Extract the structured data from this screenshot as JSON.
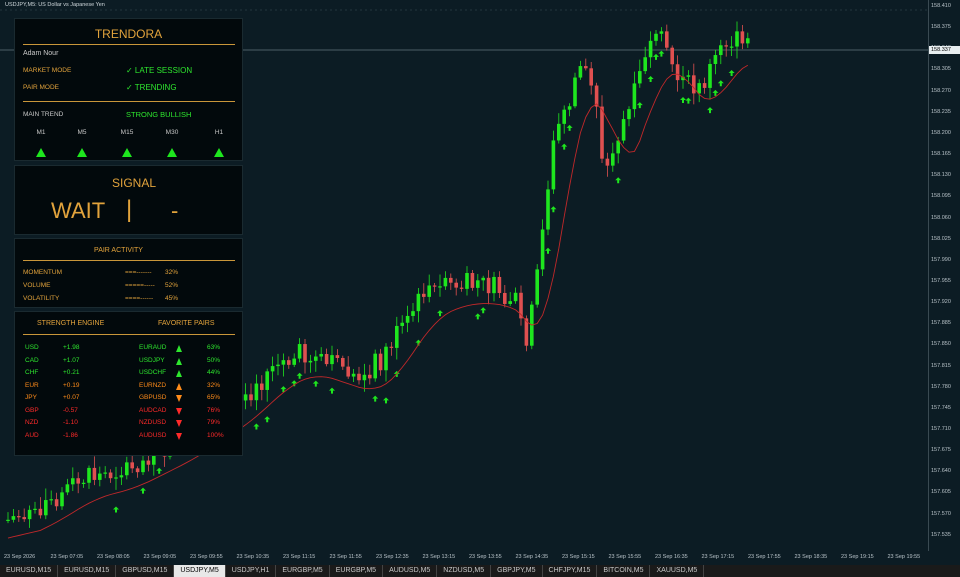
{
  "chart_title": "USDJPY,M5:  US Dollar vs Japanese Yen",
  "colors": {
    "bull": "#1ee61e",
    "bear": "#e05050",
    "ma": "#c0282a",
    "arrow": "#1ee61e",
    "bg": "#0c1c24"
  },
  "price_axis": [
    "158.410",
    "158.375",
    "158.340",
    "158.305",
    "158.270",
    "158.235",
    "158.200",
    "158.165",
    "158.130",
    "158.095",
    "158.060",
    "158.025",
    "157.990",
    "157.955",
    "157.920",
    "157.885",
    "157.850",
    "157.815",
    "157.780",
    "157.745",
    "157.710",
    "157.675",
    "157.640",
    "157.605",
    "157.570",
    "157.535"
  ],
  "current_price": "158.337",
  "time_axis": [
    "23 Sep 2026",
    "23 Sep 07:05",
    "23 Sep 08:05",
    "23 Sep 09:05",
    "23 Sep 09:55",
    "23 Sep 10:35",
    "23 Sep 11:15",
    "23 Sep 11:55",
    "23 Sep 12:35",
    "23 Sep 13:15",
    "23 Sep 13:55",
    "23 Sep 14:35",
    "23 Sep 15:15",
    "23 Sep 15:55",
    "23 Sep 16:35",
    "23 Sep 17:15",
    "23 Sep 17:55",
    "23 Sep 18:35",
    "23 Sep 19:15",
    "23 Sep 19:55"
  ],
  "tabs": [
    "EURUSD,M15",
    "EURUSD,M15",
    "GBPUSD,M15",
    "USDJPY,M5",
    "USDJPY,H1",
    "EURGBP,M5",
    "EURGBP,M5",
    "AUDUSD,M5",
    "NZDUSD,M5",
    "GBPJPY,M5",
    "CHFJPY,M15",
    "BITCOIN,M5",
    "XAUUSD,M5"
  ],
  "active_tab": 3,
  "panel": {
    "brand": "TRENDORA",
    "user": "Adam Nour",
    "market_mode_label": "MARKET MODE",
    "market_mode_value": "✓ LATE SESSION",
    "pair_mode_label": "PAIR MODE",
    "pair_mode_value": "✓ TRENDING",
    "main_trend_label": "MAIN TREND",
    "main_trend_value": "STRONG BULLISH",
    "timeframes": [
      "M1",
      "M5",
      "M15",
      "M30",
      "H1"
    ],
    "signal_label": "SIGNAL",
    "signal_value": "WAIT",
    "signal_sep": "|",
    "signal_dir": "-",
    "activity_title": "PAIR ACTIVITY",
    "activity": [
      {
        "label": "MOMENTUM",
        "bar": "===-------",
        "pct": "32%"
      },
      {
        "label": "VOLUME",
        "bar": "=====-----",
        "pct": "52%"
      },
      {
        "label": "VOLATILITY",
        "bar": "====------",
        "pct": "45%"
      }
    ],
    "strength_title": "STRENGTH ENGINE",
    "favorites_title": "FAVORITE PAIRS",
    "strength": [
      {
        "cur": "USD",
        "val": "+1.98",
        "color": "green"
      },
      {
        "cur": "CAD",
        "val": "+1.07",
        "color": "green"
      },
      {
        "cur": "CHF",
        "val": "+0.21",
        "color": "green"
      },
      {
        "cur": "EUR",
        "val": "+0.19",
        "color": "orange"
      },
      {
        "cur": "JPY",
        "val": "+0.07",
        "color": "orange"
      },
      {
        "cur": "GBP",
        "val": "-0.57",
        "color": "red"
      },
      {
        "cur": "NZD",
        "val": "-1.10",
        "color": "red"
      },
      {
        "cur": "AUD",
        "val": "-1.86",
        "color": "red"
      }
    ],
    "favorites": [
      {
        "pair": "EURAUD",
        "dir": "up",
        "pct": "63%",
        "color": "green"
      },
      {
        "pair": "USDJPY",
        "dir": "up",
        "pct": "50%",
        "color": "green"
      },
      {
        "pair": "USDCHF",
        "dir": "up",
        "pct": "44%",
        "color": "green"
      },
      {
        "pair": "EURNZD",
        "dir": "up",
        "pct": "32%",
        "color": "orange"
      },
      {
        "pair": "GBPUSD",
        "dir": "down",
        "pct": "65%",
        "color": "orange"
      },
      {
        "pair": "AUDCAD",
        "dir": "down",
        "pct": "76%",
        "color": "red"
      },
      {
        "pair": "NZDUSD",
        "dir": "down",
        "pct": "79%",
        "color": "red"
      },
      {
        "pair": "AUDUSD",
        "dir": "down",
        "pct": "100%",
        "color": "red"
      }
    ]
  }
}
